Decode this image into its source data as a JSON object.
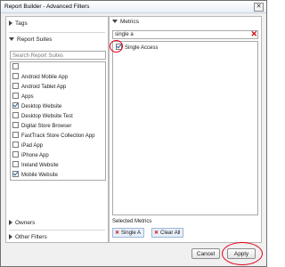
{
  "window": {
    "title": "Report Builder - Advanced Filters",
    "close_glyph": "✕"
  },
  "left": {
    "tags_label": "Tags",
    "report_suites_label": "Report Suites",
    "search_placeholder": "Search Report Suites",
    "suites": [
      {
        "label": "",
        "checked": false
      },
      {
        "label": "Android Mobile App",
        "checked": false
      },
      {
        "label": "Android Tablet App",
        "checked": false
      },
      {
        "label": "Apps",
        "checked": false
      },
      {
        "label": "Desktop Website",
        "checked": true
      },
      {
        "label": "Desktop Website Test",
        "checked": false
      },
      {
        "label": "Digital Store Browser",
        "checked": false
      },
      {
        "label": "FastTrack Store Collection App",
        "checked": false
      },
      {
        "label": "iPad App",
        "checked": false
      },
      {
        "label": "iPhone App",
        "checked": false
      },
      {
        "label": "Ireland Website",
        "checked": false
      },
      {
        "label": "Mobile Website",
        "checked": true
      }
    ],
    "owners_label": "Owners",
    "other_filters_label": "Other Filters"
  },
  "right": {
    "metrics_label": "Metrics",
    "search_value": "single a",
    "clear_glyph": "✕",
    "results": [
      {
        "label": "Single Access",
        "checked": true
      }
    ],
    "selected_label": "Selected Metrics",
    "chips": [
      {
        "label": "Single A",
        "x_glyph": "✕"
      },
      {
        "label": "Clear All",
        "x_glyph": "✕"
      }
    ]
  },
  "footer": {
    "cancel_label": "Cancel",
    "apply_label": "Apply"
  },
  "colors": {
    "highlight": "#e2001a",
    "accent": "#2a5fa0"
  }
}
